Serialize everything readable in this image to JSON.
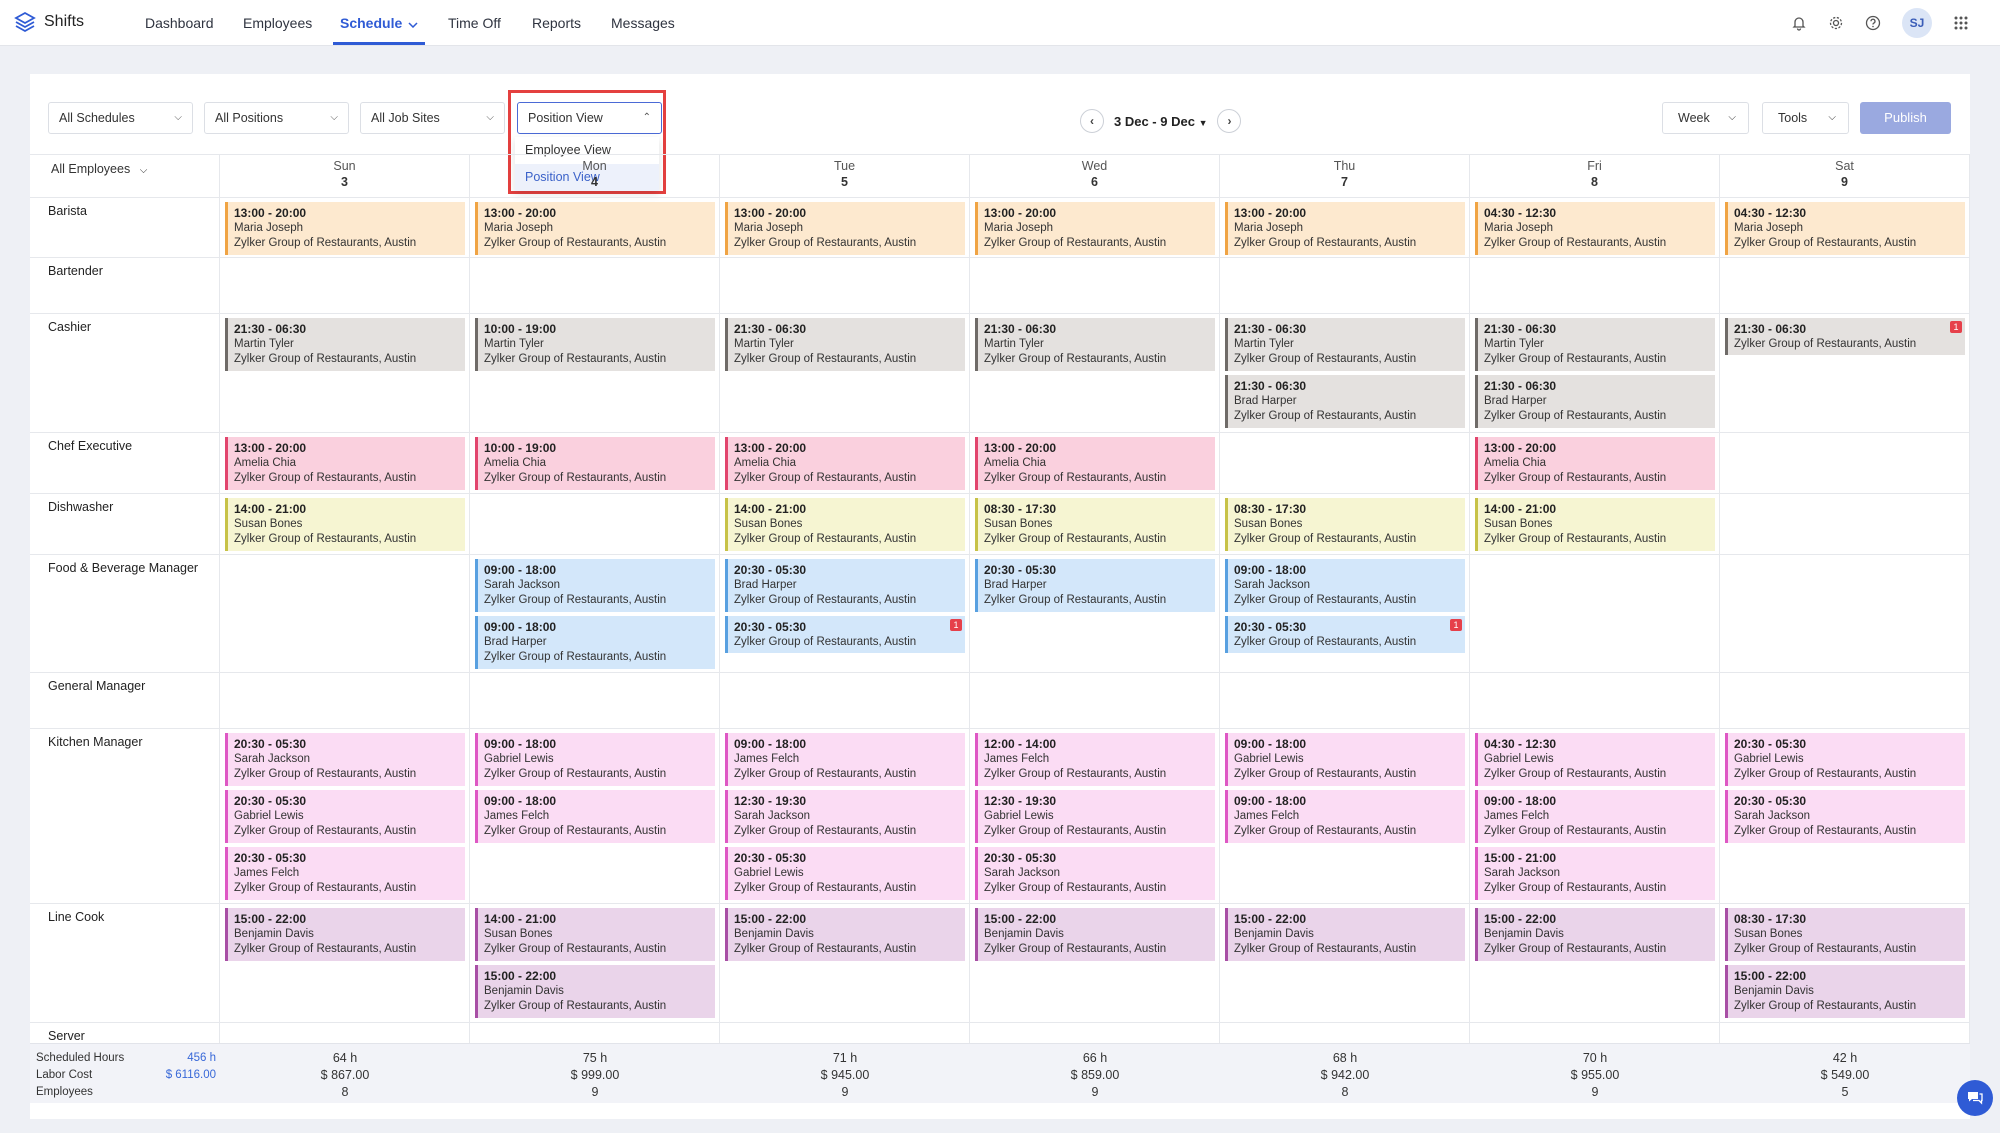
{
  "app": {
    "name": "Shifts"
  },
  "nav": [
    {
      "label": "Dashboard"
    },
    {
      "label": "Employees"
    },
    {
      "label": "Schedule"
    },
    {
      "label": "Time Off"
    },
    {
      "label": "Reports"
    },
    {
      "label": "Messages"
    }
  ],
  "user": {
    "initials": "SJ"
  },
  "toolbar": {
    "filters": [
      "All Schedules",
      "All Positions",
      "All Job Sites"
    ],
    "view_selected": "Position View",
    "view_options": [
      "Employee View",
      "Position View"
    ],
    "date_range": "3 Dec - 9 Dec",
    "period": "Week",
    "tools": "Tools",
    "publish": "Publish"
  },
  "grid": {
    "first_col": "All Employees",
    "days": [
      {
        "name": "Sun",
        "num": "3"
      },
      {
        "name": "Mon",
        "num": "4"
      },
      {
        "name": "Tue",
        "num": "5"
      },
      {
        "name": "Wed",
        "num": "6"
      },
      {
        "name": "Thu",
        "num": "7"
      },
      {
        "name": "Fri",
        "num": "8"
      },
      {
        "name": "Sat",
        "num": "9"
      }
    ],
    "positions": [
      {
        "name": "Barista",
        "color": "orange",
        "cells": [
          [
            [
              "13:00 - 20:00",
              "Maria Joseph",
              "Zylker Group of Restaurants, Austin"
            ]
          ],
          [
            [
              "13:00 - 20:00",
              "Maria Joseph",
              "Zylker Group of Restaurants, Austin"
            ]
          ],
          [
            [
              "13:00 - 20:00",
              "Maria Joseph",
              "Zylker Group of Restaurants, Austin"
            ]
          ],
          [
            [
              "13:00 - 20:00",
              "Maria Joseph",
              "Zylker Group of Restaurants, Austin"
            ]
          ],
          [
            [
              "13:00 - 20:00",
              "Maria Joseph",
              "Zylker Group of Restaurants, Austin"
            ]
          ],
          [
            [
              "04:30 - 12:30",
              "Maria Joseph",
              "Zylker Group of Restaurants, Austin"
            ]
          ],
          [
            [
              "04:30 - 12:30",
              "Maria Joseph",
              "Zylker Group of Restaurants, Austin"
            ]
          ]
        ]
      },
      {
        "name": "Bartender",
        "color": "orange",
        "cells": [
          [],
          [],
          [],
          [],
          [],
          [],
          []
        ]
      },
      {
        "name": "Cashier",
        "color": "gray",
        "cells": [
          [
            [
              "21:30 - 06:30",
              "Martin Tyler",
              "Zylker Group of Restaurants, Austin"
            ]
          ],
          [
            [
              "10:00 - 19:00",
              "Martin Tyler",
              "Zylker Group of Restaurants, Austin"
            ]
          ],
          [
            [
              "21:30 - 06:30",
              "Martin Tyler",
              "Zylker Group of Restaurants, Austin"
            ]
          ],
          [
            [
              "21:30 - 06:30",
              "Martin Tyler",
              "Zylker Group of Restaurants, Austin"
            ]
          ],
          [
            [
              "21:30 - 06:30",
              "Martin Tyler",
              "Zylker Group of Restaurants, Austin"
            ],
            [
              "21:30 - 06:30",
              "Brad Harper",
              "Zylker Group of Restaurants, Austin"
            ]
          ],
          [
            [
              "21:30 - 06:30",
              "Martin Tyler",
              "Zylker Group of Restaurants, Austin"
            ],
            [
              "21:30 - 06:30",
              "Brad Harper",
              "Zylker Group of Restaurants, Austin"
            ]
          ],
          [
            [
              "21:30 - 06:30",
              "",
              "Zylker Group of Restaurants, Austin",
              "1"
            ]
          ]
        ]
      },
      {
        "name": "Chef Executive",
        "color": "pink",
        "cells": [
          [
            [
              "13:00 - 20:00",
              "Amelia Chia",
              "Zylker Group of Restaurants, Austin"
            ]
          ],
          [
            [
              "10:00 - 19:00",
              "Amelia Chia",
              "Zylker Group of Restaurants, Austin"
            ]
          ],
          [
            [
              "13:00 - 20:00",
              "Amelia Chia",
              "Zylker Group of Restaurants, Austin"
            ]
          ],
          [
            [
              "13:00 - 20:00",
              "Amelia Chia",
              "Zylker Group of Restaurants, Austin"
            ]
          ],
          [],
          [
            [
              "13:00 - 20:00",
              "Amelia Chia",
              "Zylker Group of Restaurants, Austin"
            ]
          ],
          []
        ]
      },
      {
        "name": "Dishwasher",
        "color": "yellow",
        "cells": [
          [
            [
              "14:00 - 21:00",
              "Susan Bones",
              "Zylker Group of Restaurants, Austin"
            ]
          ],
          [],
          [
            [
              "14:00 - 21:00",
              "Susan Bones",
              "Zylker Group of Restaurants, Austin"
            ]
          ],
          [
            [
              "08:30 - 17:30",
              "Susan Bones",
              "Zylker Group of Restaurants, Austin"
            ]
          ],
          [
            [
              "08:30 - 17:30",
              "Susan Bones",
              "Zylker Group of Restaurants, Austin"
            ]
          ],
          [
            [
              "14:00 - 21:00",
              "Susan Bones",
              "Zylker Group of Restaurants, Austin"
            ]
          ],
          []
        ]
      },
      {
        "name": "Food & Beverage Manager",
        "color": "blue",
        "cells": [
          [],
          [
            [
              "09:00 - 18:00",
              "Sarah Jackson",
              "Zylker Group of Restaurants, Austin"
            ],
            [
              "09:00 - 18:00",
              "Brad Harper",
              "Zylker Group of Restaurants, Austin"
            ]
          ],
          [
            [
              "20:30 - 05:30",
              "Brad Harper",
              "Zylker Group of Restaurants, Austin"
            ],
            [
              "20:30 - 05:30",
              "",
              "Zylker Group of Restaurants, Austin",
              "1"
            ]
          ],
          [
            [
              "20:30 - 05:30",
              "Brad Harper",
              "Zylker Group of Restaurants, Austin"
            ]
          ],
          [
            [
              "09:00 - 18:00",
              "Sarah Jackson",
              "Zylker Group of Restaurants, Austin"
            ],
            [
              "20:30 - 05:30",
              "",
              "Zylker Group of Restaurants, Austin",
              "1"
            ]
          ],
          [],
          []
        ]
      },
      {
        "name": "General Manager",
        "color": "blue",
        "cells": [
          [],
          [],
          [],
          [],
          [],
          [],
          []
        ]
      },
      {
        "name": "Kitchen Manager",
        "color": "magenta",
        "cells": [
          [
            [
              "20:30 - 05:30",
              "Sarah Jackson",
              "Zylker Group of Restaurants, Austin"
            ],
            [
              "20:30 - 05:30",
              "Gabriel Lewis",
              "Zylker Group of Restaurants, Austin"
            ],
            [
              "20:30 - 05:30",
              "James Felch",
              "Zylker Group of Restaurants, Austin"
            ]
          ],
          [
            [
              "09:00 - 18:00",
              "Gabriel Lewis",
              "Zylker Group of Restaurants, Austin"
            ],
            [
              "09:00 - 18:00",
              "James Felch",
              "Zylker Group of Restaurants, Austin"
            ]
          ],
          [
            [
              "09:00 - 18:00",
              "James Felch",
              "Zylker Group of Restaurants, Austin"
            ],
            [
              "12:30 - 19:30",
              "Sarah Jackson",
              "Zylker Group of Restaurants, Austin"
            ],
            [
              "20:30 - 05:30",
              "Gabriel Lewis",
              "Zylker Group of Restaurants, Austin"
            ]
          ],
          [
            [
              "12:00 - 14:00",
              "James Felch",
              "Zylker Group of Restaurants, Austin"
            ],
            [
              "12:30 - 19:30",
              "Gabriel Lewis",
              "Zylker Group of Restaurants, Austin"
            ],
            [
              "20:30 - 05:30",
              "Sarah Jackson",
              "Zylker Group of Restaurants, Austin"
            ]
          ],
          [
            [
              "09:00 - 18:00",
              "Gabriel Lewis",
              "Zylker Group of Restaurants, Austin"
            ],
            [
              "09:00 - 18:00",
              "James Felch",
              "Zylker Group of Restaurants, Austin"
            ]
          ],
          [
            [
              "04:30 - 12:30",
              "Gabriel Lewis",
              "Zylker Group of Restaurants, Austin"
            ],
            [
              "09:00 - 18:00",
              "James Felch",
              "Zylker Group of Restaurants, Austin"
            ],
            [
              "15:00 - 21:00",
              "Sarah Jackson",
              "Zylker Group of Restaurants, Austin"
            ]
          ],
          [
            [
              "20:30 - 05:30",
              "Gabriel Lewis",
              "Zylker Group of Restaurants, Austin"
            ],
            [
              "20:30 - 05:30",
              "Sarah Jackson",
              "Zylker Group of Restaurants, Austin"
            ]
          ]
        ]
      },
      {
        "name": "Line Cook",
        "color": "purple",
        "cells": [
          [
            [
              "15:00 - 22:00",
              "Benjamin Davis",
              "Zylker Group of Restaurants, Austin"
            ]
          ],
          [
            [
              "14:00 - 21:00",
              "Susan Bones",
              "Zylker Group of Restaurants, Austin"
            ],
            [
              "15:00 - 22:00",
              "Benjamin Davis",
              "Zylker Group of Restaurants, Austin"
            ]
          ],
          [
            [
              "15:00 - 22:00",
              "Benjamin Davis",
              "Zylker Group of Restaurants, Austin"
            ]
          ],
          [
            [
              "15:00 - 22:00",
              "Benjamin Davis",
              "Zylker Group of Restaurants, Austin"
            ]
          ],
          [
            [
              "15:00 - 22:00",
              "Benjamin Davis",
              "Zylker Group of Restaurants, Austin"
            ]
          ],
          [
            [
              "15:00 - 22:00",
              "Benjamin Davis",
              "Zylker Group of Restaurants, Austin"
            ]
          ],
          [
            [
              "08:30 - 17:30",
              "Susan Bones",
              "Zylker Group of Restaurants, Austin"
            ],
            [
              "15:00 - 22:00",
              "Benjamin Davis",
              "Zylker Group of Restaurants, Austin"
            ]
          ]
        ]
      },
      {
        "name": "Server",
        "color": "purple",
        "cells": [
          [],
          [],
          [],
          [],
          [],
          [],
          []
        ]
      }
    ]
  },
  "footer": {
    "labels": [
      "Scheduled Hours",
      "Labor Cost",
      "Employees"
    ],
    "totals": [
      "456 h",
      "$ 6116.00"
    ],
    "days": [
      [
        "64 h",
        "$ 867.00",
        "8"
      ],
      [
        "75 h",
        "$ 999.00",
        "9"
      ],
      [
        "71 h",
        "$ 945.00",
        "9"
      ],
      [
        "66 h",
        "$ 859.00",
        "9"
      ],
      [
        "68 h",
        "$ 942.00",
        "8"
      ],
      [
        "70 h",
        "$ 955.00",
        "9"
      ],
      [
        "42 h",
        "$ 549.00",
        "5"
      ]
    ]
  }
}
